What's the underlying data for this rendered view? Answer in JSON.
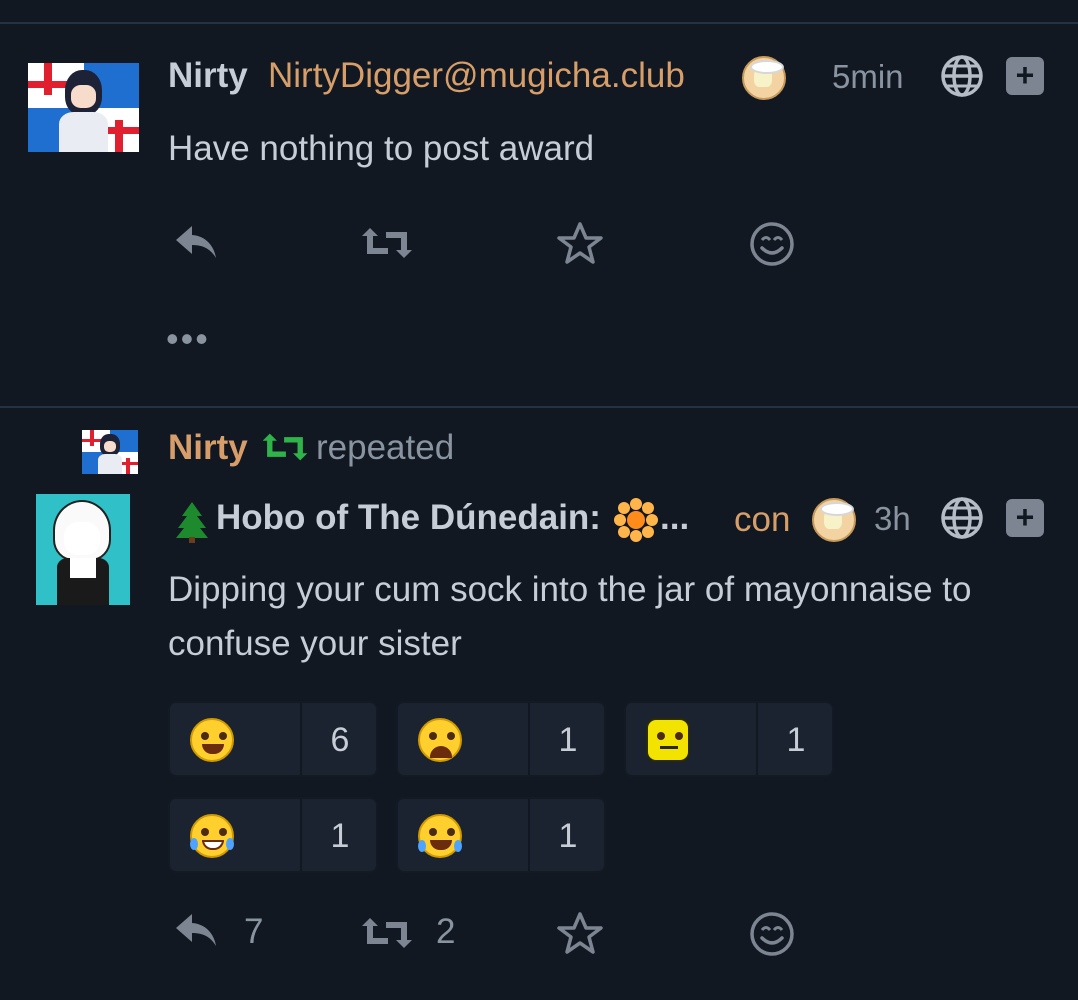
{
  "posts": [
    {
      "author": "Nirty",
      "handle": "NirtyDigger@mugicha.club",
      "time": "5min",
      "content": "Have nothing to post award",
      "menu_more": "•••",
      "actions": {
        "reply_count": "",
        "boost_count": ""
      }
    },
    {
      "repeated_by": "Nirty",
      "repeated_label": "repeated",
      "author": "Hobo of The Dúnedain:",
      "author_ellipsis": "...",
      "handle": "con",
      "time": "3h",
      "content": "Dipping your cum sock into the jar of mayonnaise to confuse your sister",
      "reactions": [
        {
          "emoji": "grinning-squinting-face",
          "count": "6"
        },
        {
          "emoji": "weary-face",
          "count": "1"
        },
        {
          "emoji": "neutral-face",
          "count": "1"
        },
        {
          "emoji": "rolling-on-the-floor-laughing",
          "count": "1"
        },
        {
          "emoji": "face-with-tears-of-joy",
          "count": "1"
        }
      ],
      "actions": {
        "reply_count": "7",
        "boost_count": "2"
      }
    }
  ],
  "icons": {
    "reply": "reply-icon",
    "boost": "boost-icon",
    "favorite": "star-icon",
    "emoji": "emoji-icon",
    "globe": "globe-icon",
    "plus": "plus-icon",
    "repeat": "repeat-icon",
    "tree": "tree-icon",
    "flower": "flower-icon"
  },
  "colors": {
    "background": "#111821",
    "text": "#c7cdd6",
    "accent": "#d79e6a",
    "muted": "#8a93a0",
    "boost_green": "#2fb44a",
    "divider": "#253242"
  }
}
